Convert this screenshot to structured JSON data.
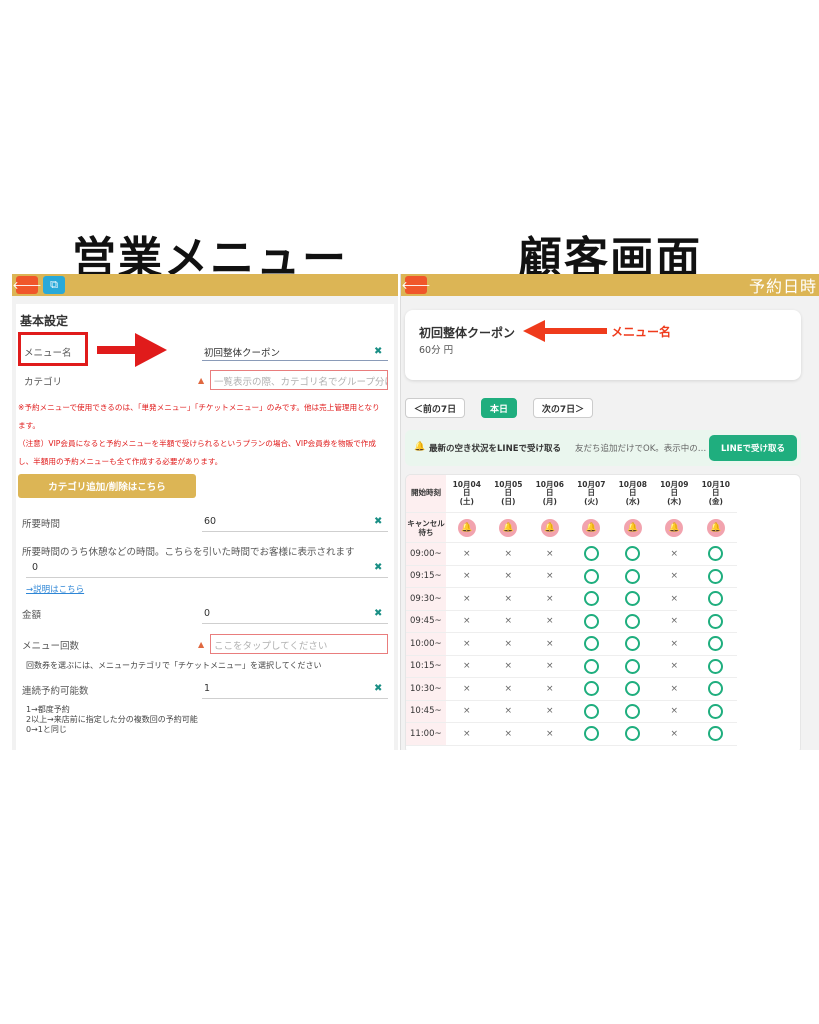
{
  "headings": {
    "left": "営業メニュー",
    "right": "顧客画面"
  },
  "colors": {
    "topbar": "#dcb555",
    "back_button": "#f0562a",
    "copy_button": "#29a9d8",
    "accent_green": "#1fae7e",
    "annotation_red": "#e01b1b"
  },
  "left": {
    "section_title": "基本設定",
    "menu_name": {
      "label": "メニュー名",
      "value": "初回整体クーポン"
    },
    "category": {
      "label": "カテゴリ",
      "placeholder": "一覧表示の際、カテゴリ名でグループ分け"
    },
    "notes": [
      "※予約メニューで使用できるのは、「単発メニュー」「チケットメニュー」のみです。他は売上管理用となり",
      "ます。",
      "（注意）VIP会員になると予約メニューを半額で受けられるというプランの場合、VIP会員券を物販で作成",
      "し、半額用の予約メニューも全て作成する必要があります。"
    ],
    "category_button": "カテゴリ追加/削除はこちら",
    "duration": {
      "label": "所要時間",
      "value": "60"
    },
    "break_time": {
      "label": "所要時間のうち休憩などの時間。こちらを引いた時間でお客様に表示されます",
      "value": "0"
    },
    "explanation_link": "→説明はこちら",
    "price": {
      "label": "金額",
      "value": "0"
    },
    "menu_count": {
      "label": "メニュー回数",
      "placeholder": "ここをタップしてください",
      "help": "回数券を選ぶには、メニューカテゴリで「チケットメニュー」を選択してください"
    },
    "consecutive": {
      "label": "連続予約可能数",
      "value": "1",
      "help": [
        "1→都度予約",
        "2以上→来店前に指定した分の複数回の予約可能",
        "0→1と同じ"
      ]
    }
  },
  "right": {
    "header_title": "予約日時",
    "menu_card": {
      "name": "初回整体クーポン",
      "duration": "60分 円",
      "annotation": "メニュー名"
    },
    "nav": {
      "prev": "＜前の7日",
      "today": "本日",
      "next": "次の7日＞"
    },
    "line_banner": {
      "main": "最新の空き状況をLINEで受け取る",
      "sub": "友だち追加だけでOK。表示中の…",
      "button": "LINEで受け取る"
    },
    "schedule": {
      "corner": "開始時刻",
      "days": [
        {
          "date": "10月04",
          "day": "日",
          "wd": "(土)"
        },
        {
          "date": "10月05",
          "day": "日",
          "wd": "(日)"
        },
        {
          "date": "10月06",
          "day": "日",
          "wd": "(月)"
        },
        {
          "date": "10月07",
          "day": "日",
          "wd": "(火)"
        },
        {
          "date": "10月08",
          "day": "日",
          "wd": "(水)"
        },
        {
          "date": "10月09",
          "day": "日",
          "wd": "(木)"
        },
        {
          "date": "10月10",
          "day": "日",
          "wd": "(金)"
        }
      ],
      "cancel_label": "キャンセル待ち",
      "x_symbol": "×",
      "rows": [
        {
          "time": "09:00~",
          "slots": [
            "x",
            "x",
            "x",
            "o",
            "o",
            "x",
            "o"
          ]
        },
        {
          "time": "09:15~",
          "slots": [
            "x",
            "x",
            "x",
            "o",
            "o",
            "x",
            "o"
          ]
        },
        {
          "time": "09:30~",
          "slots": [
            "x",
            "x",
            "x",
            "o",
            "o",
            "x",
            "o"
          ]
        },
        {
          "time": "09:45~",
          "slots": [
            "x",
            "x",
            "x",
            "o",
            "o",
            "x",
            "o"
          ]
        },
        {
          "time": "10:00~",
          "slots": [
            "x",
            "x",
            "x",
            "o",
            "o",
            "x",
            "o"
          ]
        },
        {
          "time": "10:15~",
          "slots": [
            "x",
            "x",
            "x",
            "o",
            "o",
            "x",
            "o"
          ]
        },
        {
          "time": "10:30~",
          "slots": [
            "x",
            "x",
            "x",
            "o",
            "o",
            "x",
            "o"
          ]
        },
        {
          "time": "10:45~",
          "slots": [
            "x",
            "x",
            "x",
            "o",
            "o",
            "x",
            "o"
          ]
        },
        {
          "time": "11:00~",
          "slots": [
            "x",
            "x",
            "x",
            "o",
            "o",
            "x",
            "o"
          ]
        }
      ]
    }
  }
}
